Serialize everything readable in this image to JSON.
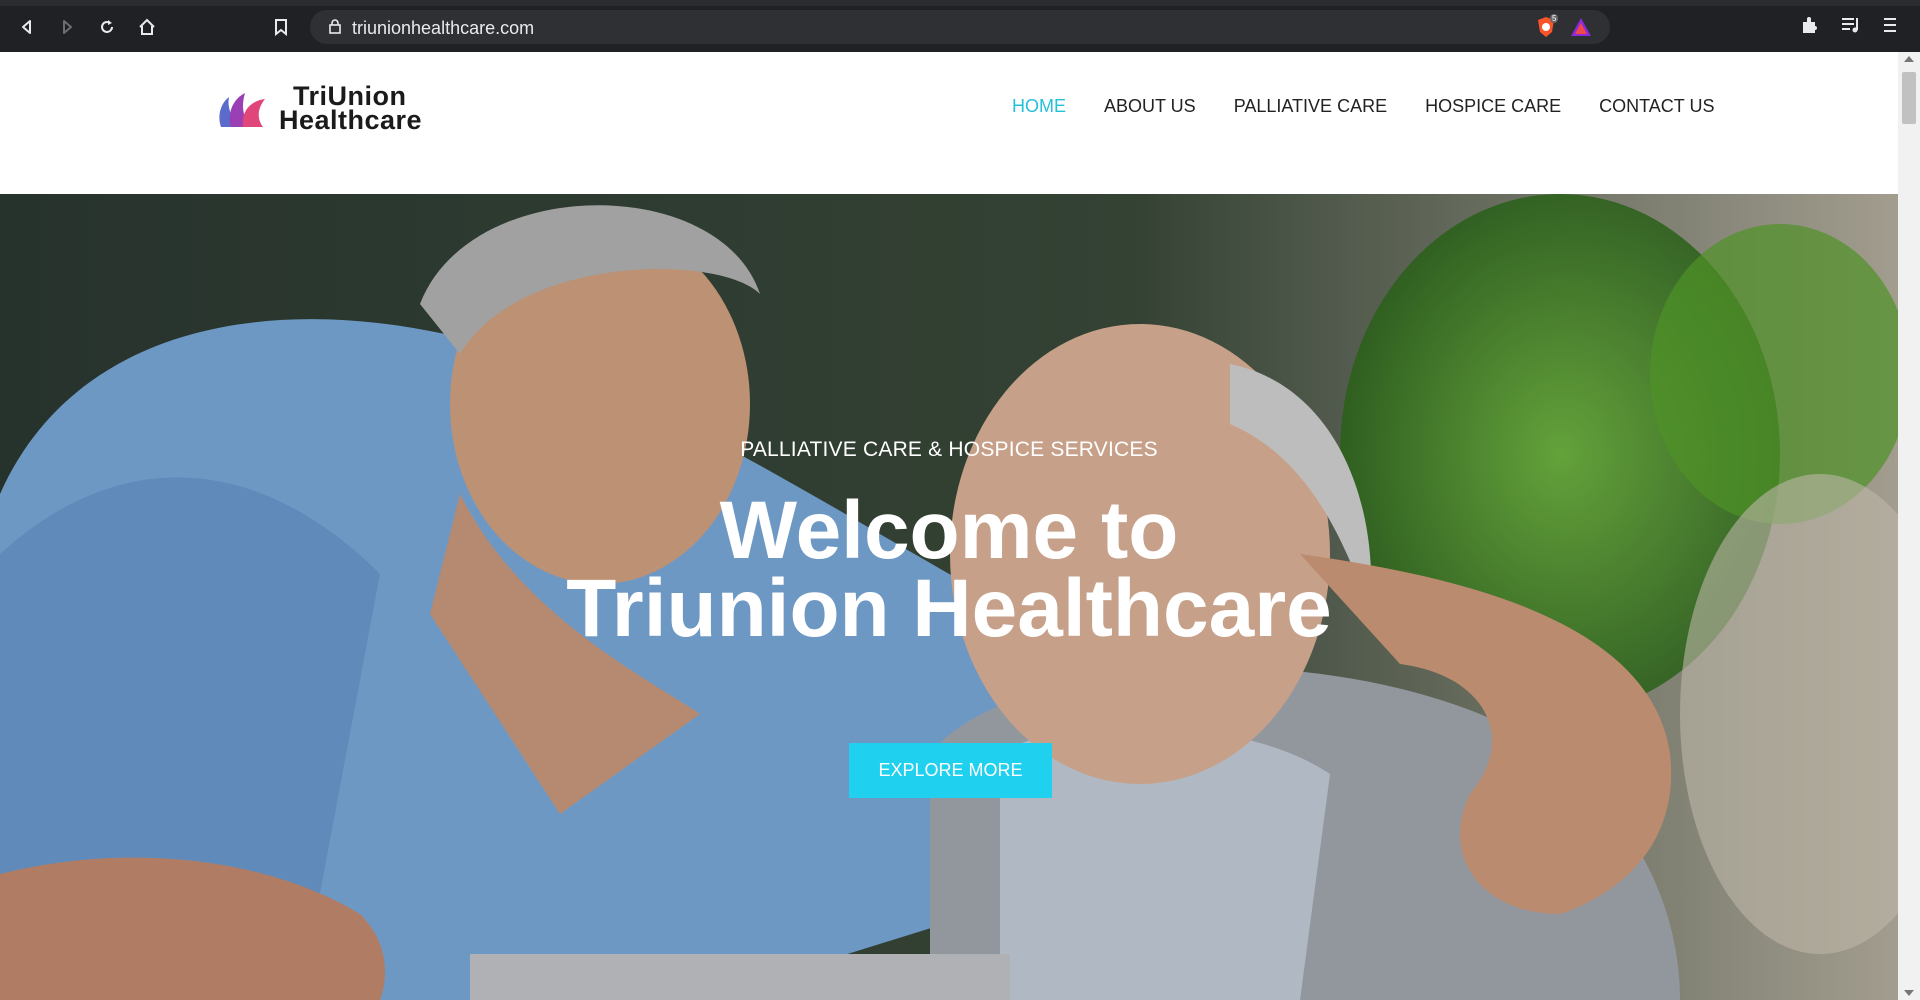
{
  "browser": {
    "url": "triunionhealthcare.com",
    "extension_badge": "5",
    "icons": [
      "back-icon",
      "forward-icon",
      "reload-icon",
      "home-icon",
      "bookmark-icon",
      "lock-icon",
      "brave-shield-icon",
      "brave-rewards-icon",
      "extensions-icon",
      "playlist-icon",
      "menu-icon"
    ]
  },
  "site": {
    "logo": {
      "line1": "TriUnion",
      "line2": "Healthcare"
    },
    "nav": [
      {
        "label": "HOME",
        "active": true
      },
      {
        "label": "ABOUT US",
        "active": false
      },
      {
        "label": "PALLIATIVE CARE",
        "active": false
      },
      {
        "label": "HOSPICE CARE",
        "active": false
      },
      {
        "label": "CONTACT US",
        "active": false
      }
    ],
    "hero": {
      "subtitle": "PALLIATIVE CARE & HOSPICE SERVICES",
      "title_line1": "Welcome to",
      "title_line2": "Triunion Healthcare",
      "button": "EXPLORE MORE"
    }
  },
  "colors": {
    "accent": "#26bfd9",
    "button": "#1fd0ef",
    "browser_chrome": "#202124"
  }
}
